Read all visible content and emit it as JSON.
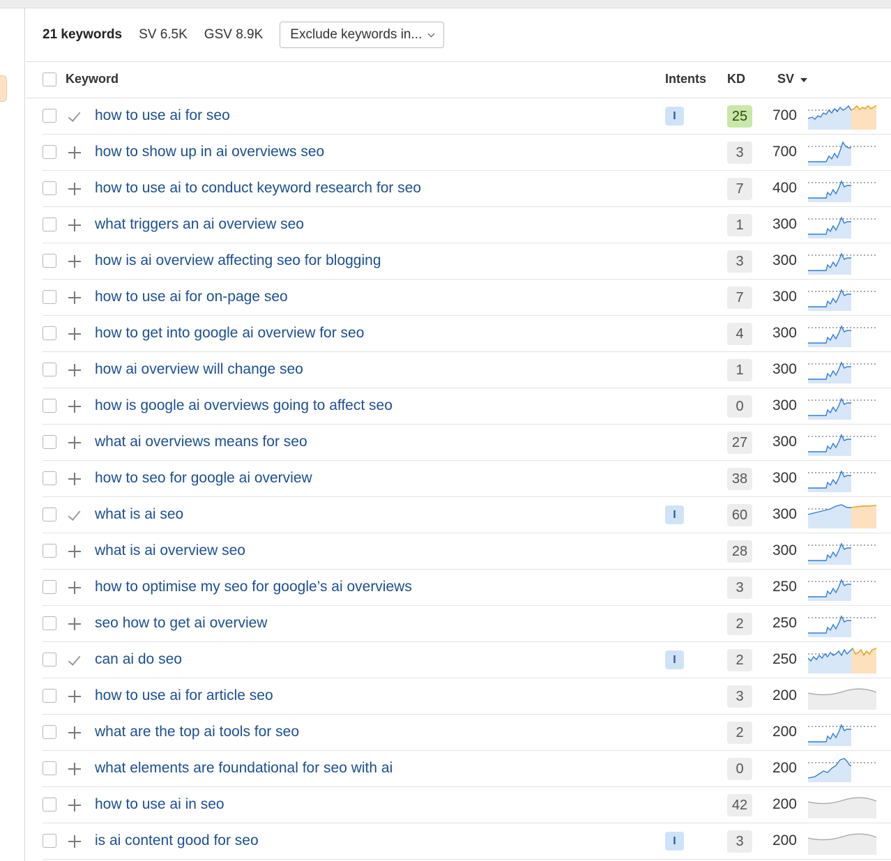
{
  "summary": {
    "count": "21 keywords",
    "sv": "SV 6.5K",
    "gsv": "GSV 8.9K",
    "filter_label": "Exclude keywords in..."
  },
  "table": {
    "headers": {
      "keyword": "Keyword",
      "intents": "Intents",
      "kd": "KD",
      "sv": "SV"
    },
    "sort": {
      "column": "SV",
      "direction": "descending"
    },
    "colors": {
      "link": "#1b4f93",
      "kd_easy": "#c9e7a8",
      "intent_badge": "#cfe3f7",
      "trend_line": "#2f7ed8",
      "trend_recent": "#f5a623"
    },
    "rows": [
      {
        "keyword": "how to use ai for seo",
        "status": "added",
        "intent": "I",
        "kd": "25",
        "sv": "700",
        "trend": "spiky",
        "recent": true
      },
      {
        "keyword": "how to show up in ai overviews seo",
        "status": "add",
        "intent": "",
        "kd": "3",
        "sv": "700",
        "trend": "spike-late"
      },
      {
        "keyword": "how to use ai to conduct keyword research for seo",
        "status": "add",
        "intent": "",
        "kd": "7",
        "sv": "400",
        "trend": "spike"
      },
      {
        "keyword": "what triggers an ai overview seo",
        "status": "add",
        "intent": "",
        "kd": "1",
        "sv": "300",
        "trend": "spike"
      },
      {
        "keyword": "how is ai overview affecting seo for blogging",
        "status": "add",
        "intent": "",
        "kd": "3",
        "sv": "300",
        "trend": "spike"
      },
      {
        "keyword": "how to use ai for on-page seo",
        "status": "add",
        "intent": "",
        "kd": "7",
        "sv": "300",
        "trend": "spike"
      },
      {
        "keyword": "how to get into google ai overview for seo",
        "status": "add",
        "intent": "",
        "kd": "4",
        "sv": "300",
        "trend": "spike"
      },
      {
        "keyword": "how ai overview will change seo",
        "status": "add",
        "intent": "",
        "kd": "1",
        "sv": "300",
        "trend": "spike"
      },
      {
        "keyword": "how is google ai overviews going to affect seo",
        "status": "add",
        "intent": "",
        "kd": "0",
        "sv": "300",
        "trend": "spike"
      },
      {
        "keyword": "what ai overviews means for seo",
        "status": "add",
        "intent": "",
        "kd": "27",
        "sv": "300",
        "trend": "spike"
      },
      {
        "keyword": "how to seo for google ai overview",
        "status": "add",
        "intent": "",
        "kd": "38",
        "sv": "300",
        "trend": "spike"
      },
      {
        "keyword": "what is ai seo",
        "status": "added",
        "intent": "I",
        "kd": "60",
        "sv": "300",
        "trend": "smooth-rise",
        "recent": true
      },
      {
        "keyword": "what is ai overview seo",
        "status": "add",
        "intent": "",
        "kd": "28",
        "sv": "300",
        "trend": "spike"
      },
      {
        "keyword": "how to optimise my seo for google’s ai overviews",
        "status": "add",
        "intent": "",
        "kd": "3",
        "sv": "250",
        "trend": "spike"
      },
      {
        "keyword": "seo how to get ai overview",
        "status": "add",
        "intent": "",
        "kd": "2",
        "sv": "250",
        "trend": "spike"
      },
      {
        "keyword": "can ai do seo",
        "status": "added",
        "intent": "I",
        "kd": "2",
        "sv": "250",
        "trend": "zigzag",
        "recent": true
      },
      {
        "keyword": "how to use ai for article seo",
        "status": "add",
        "intent": "",
        "kd": "3",
        "sv": "200",
        "trend": "gray"
      },
      {
        "keyword": "what are the top ai tools for seo",
        "status": "add",
        "intent": "",
        "kd": "2",
        "sv": "200",
        "trend": "spike"
      },
      {
        "keyword": "what elements are foundational for seo with ai",
        "status": "add",
        "intent": "",
        "kd": "0",
        "sv": "200",
        "trend": "hump"
      },
      {
        "keyword": "how to use ai in seo",
        "status": "add",
        "intent": "",
        "kd": "42",
        "sv": "200",
        "trend": "gray"
      },
      {
        "keyword": "is ai content good for seo",
        "status": "add",
        "intent": "I",
        "kd": "3",
        "sv": "200",
        "trend": "gray"
      }
    ]
  }
}
